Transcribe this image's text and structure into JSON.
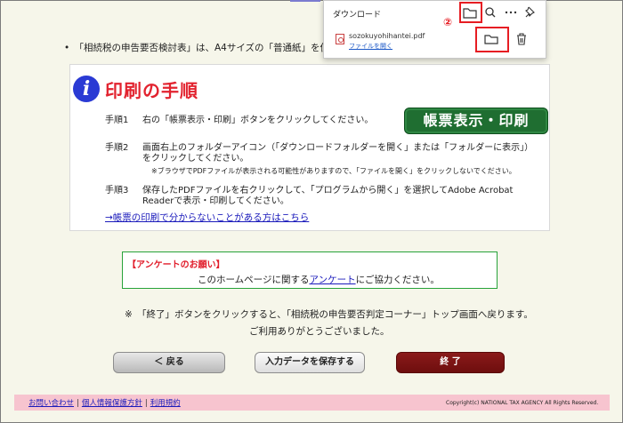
{
  "page": {
    "bullet_text": "「相続税の申告要否検討表」は、A4サイズの「普通紙」を使",
    "section_title": "印刷の手順",
    "info_icon_letter": "i",
    "steps": [
      {
        "num": "手順1",
        "text": "右の「帳票表示・印刷」ボタンをクリックしてください。"
      },
      {
        "num": "手順2",
        "text": "画面右上のフォルダーアイコン（「ダウンロードフォルダーを開く」または「フォルダーに表示」）をクリックしてください。"
      },
      {
        "num": "手順3",
        "text": "保存したPDFファイルを右クリックして、「プログラムから開く」を選択してAdobe Acrobat Readerで表示・印刷してください。"
      }
    ],
    "step2_note": "※ブラウザでPDFファイルが表示される可能性がありますので、「ファイルを開く」をクリックしないでください。",
    "trouble_link": "→帳票の印刷で分からないことがある方はこちら",
    "form_button": "帳票表示・印刷",
    "survey_title": "【アンケートのお願い】",
    "survey_prefix": "このホームページに関する",
    "survey_link": "アンケート",
    "survey_suffix": "にご協力ください。",
    "return_note_1": "※　「終了」ボタンをクリックすると、「相続税の申告要否判定コーナー」トップ画面へ戻ります。",
    "return_note_2": "ご利用ありがとうございました。",
    "back_button": "＜ 戻る",
    "save_button": "入力データを保存する",
    "end_button": "終 了"
  },
  "footer": {
    "links": [
      "お問い合わせ",
      "個人情報保護方針",
      "利用規約"
    ],
    "separator": "|",
    "copyright": "Copyright(c) NATIONAL TAX AGENCY All Rights Reserved."
  },
  "download_panel": {
    "title": "ダウンロード",
    "step_badge": "②",
    "file_name": "sozokuyohihantei.pdf",
    "open_file": "ファイルを開く",
    "icons": [
      "folder-icon",
      "search-icon",
      "more-icon",
      "pin-icon",
      "folder-icon",
      "trash-icon",
      "pdf-file-icon"
    ]
  },
  "colors": {
    "page_bg": "#f6f6ea",
    "title_red": "#e2232f",
    "info_blue": "#2a3ad4",
    "form_button_green": "#1f6e31",
    "end_button_maroon": "#7a1414",
    "highlight_red": "#e61d23",
    "footer_pink": "#f7c4cf",
    "survey_border_green": "#27a33a",
    "link_blue": "#1a1abb"
  }
}
